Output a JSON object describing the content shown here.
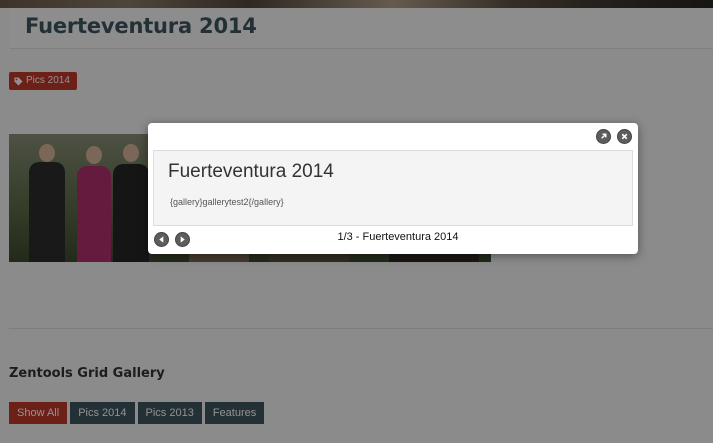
{
  "page": {
    "title": "Fuerteventura 2014",
    "tag_label": "Pics 2014"
  },
  "gallery": {
    "title": "Zentools Grid Gallery",
    "filters": [
      {
        "label": "Show All",
        "active": true
      },
      {
        "label": "Pics 2014",
        "active": false
      },
      {
        "label": "Pics 2013",
        "active": false
      },
      {
        "label": "Features",
        "active": false
      }
    ]
  },
  "lightbox": {
    "title": "Fuerteventura 2014",
    "body_text": "{gallery}gallerytest2{/gallery}",
    "caption": "1/3 - Fuerteventura 2014"
  },
  "icons": {
    "tag": "tag-icon",
    "expand": "expand-icon",
    "close": "close-icon",
    "prev": "arrow-left-icon",
    "next": "arrow-right-icon"
  },
  "colors": {
    "accent_red": "#c0392b",
    "slate": "#3f5560",
    "overlay": "#000000"
  }
}
